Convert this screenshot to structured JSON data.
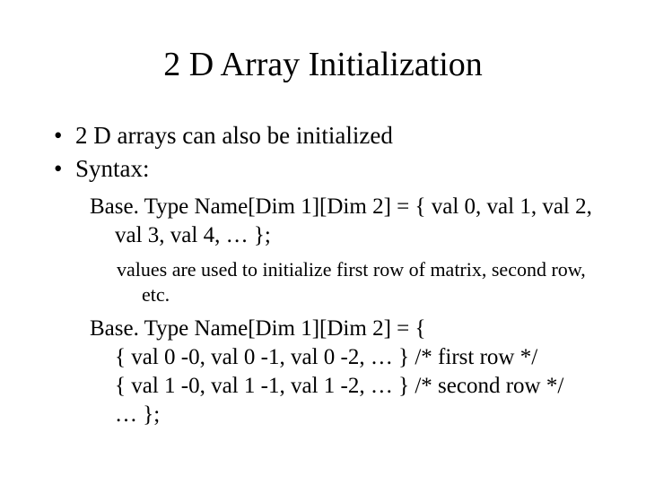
{
  "title": "2 D Array Initialization",
  "bullets": [
    "2 D arrays can also be initialized",
    "Syntax:"
  ],
  "syntax1": "Base. Type Name[Dim 1][Dim 2] = { val 0, val 1, val 2, val 3, val 4, … };",
  "note": "values are used to initialize first row of matrix, second row, etc.",
  "syntax2": {
    "l0": "Base. Type Name[Dim 1][Dim 2] = {",
    "l1": "{ val 0 -0, val 0 -1, val 0 -2, … }  /* first row */",
    "l2": "{ val 1 -0, val 1 -1, val 1 -2, … }  /* second row */",
    "l3": "… };"
  }
}
